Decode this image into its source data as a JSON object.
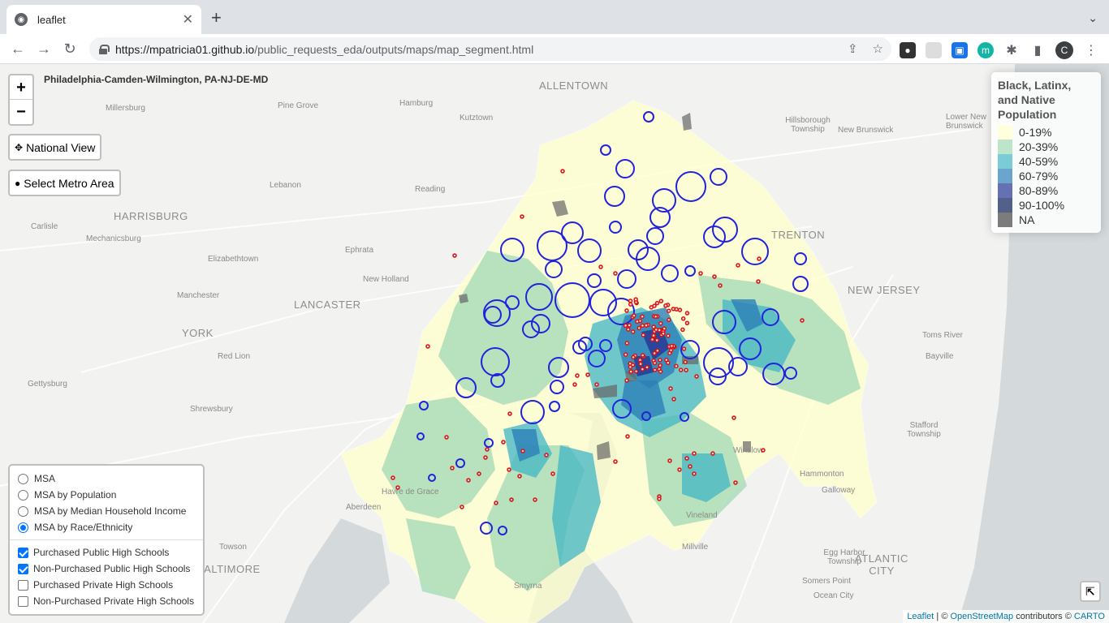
{
  "browser": {
    "tab_title": "leaflet",
    "url_host": "https://mpatricia01.github.io",
    "url_path": "/public_requests_eda/outputs/maps/map_segment.html",
    "profile_initial": "C",
    "ext_m_label": "m"
  },
  "map": {
    "title": "Philadelphia-Camden-Wilmington, PA-NJ-DE-MD",
    "zoom_in": "+",
    "zoom_out": "−",
    "national_view": "National View",
    "select_metro": "Select Metro Area",
    "fullscreen_icon": "⇱",
    "places": [
      {
        "name": "ALLENTOWN",
        "big": true
      },
      {
        "name": "Millersburg"
      },
      {
        "name": "Pine Grove"
      },
      {
        "name": "Hamburg"
      },
      {
        "name": "Kutztown"
      },
      {
        "name": "Hillsborough Township"
      },
      {
        "name": "New Brunswick"
      },
      {
        "name": "Lower New Brunswick"
      },
      {
        "name": "Lebanon"
      },
      {
        "name": "Reading"
      },
      {
        "name": "HARRISBURG",
        "big": true
      },
      {
        "name": "Carlisle"
      },
      {
        "name": "Mechanicsburg"
      },
      {
        "name": "Elizabethtown"
      },
      {
        "name": "Ephrata"
      },
      {
        "name": "New Holland"
      },
      {
        "name": "Manchester"
      },
      {
        "name": "LANCASTER",
        "big": true
      },
      {
        "name": "YORK",
        "big": true
      },
      {
        "name": "Red Lion"
      },
      {
        "name": "Gettysburg"
      },
      {
        "name": "Shrewsbury"
      },
      {
        "name": "TRENTON",
        "big": true
      },
      {
        "name": "NEW JERSEY",
        "big": true
      },
      {
        "name": "Toms River"
      },
      {
        "name": "Bayville"
      },
      {
        "name": "Stafford Township"
      },
      {
        "name": "Egg Harbor Township"
      },
      {
        "name": "ATLANTIC CITY",
        "big": true
      },
      {
        "name": "Somers Point"
      },
      {
        "name": "Ocean City"
      },
      {
        "name": "Havre de Grace"
      },
      {
        "name": "Aberdeen"
      },
      {
        "name": "Towson"
      },
      {
        "name": "BALTIMORE",
        "big": true
      },
      {
        "name": "Smyrna"
      },
      {
        "name": "Millville"
      },
      {
        "name": "Vineland"
      },
      {
        "name": "Winslow"
      },
      {
        "name": "Galloway"
      },
      {
        "name": "Hammonton"
      }
    ]
  },
  "legend": {
    "title": "Black, Latinx, and Native Population",
    "items": [
      {
        "label": "0-19%",
        "color": "#ffffcc"
      },
      {
        "label": "20-39%",
        "color": "#a1dab4"
      },
      {
        "label": "40-59%",
        "color": "#41b6c4"
      },
      {
        "label": "60-79%",
        "color": "#2c7fb8"
      },
      {
        "label": "80-89%",
        "color": "#253494"
      },
      {
        "label": "90-100%",
        "color": "#081d58"
      },
      {
        "label": "NA",
        "color": "#444444"
      }
    ]
  },
  "layers": {
    "base": [
      {
        "label": "MSA",
        "checked": false
      },
      {
        "label": "MSA by Population",
        "checked": false
      },
      {
        "label": "MSA by Median Household Income",
        "checked": false
      },
      {
        "label": "MSA by Race/Ethnicity",
        "checked": true
      }
    ],
    "overlays": [
      {
        "label": "Purchased Public High Schools",
        "checked": true
      },
      {
        "label": "Non-Purchased Public High Schools",
        "checked": true
      },
      {
        "label": "Purchased Private High Schools",
        "checked": false
      },
      {
        "label": "Non-Purchased Private High Schools",
        "checked": false
      }
    ]
  },
  "attribution": {
    "leaflet": "Leaflet",
    "sep1": " | © ",
    "osm": "OpenStreetMap",
    "contrib": " contributors © ",
    "carto": "CARTO"
  }
}
